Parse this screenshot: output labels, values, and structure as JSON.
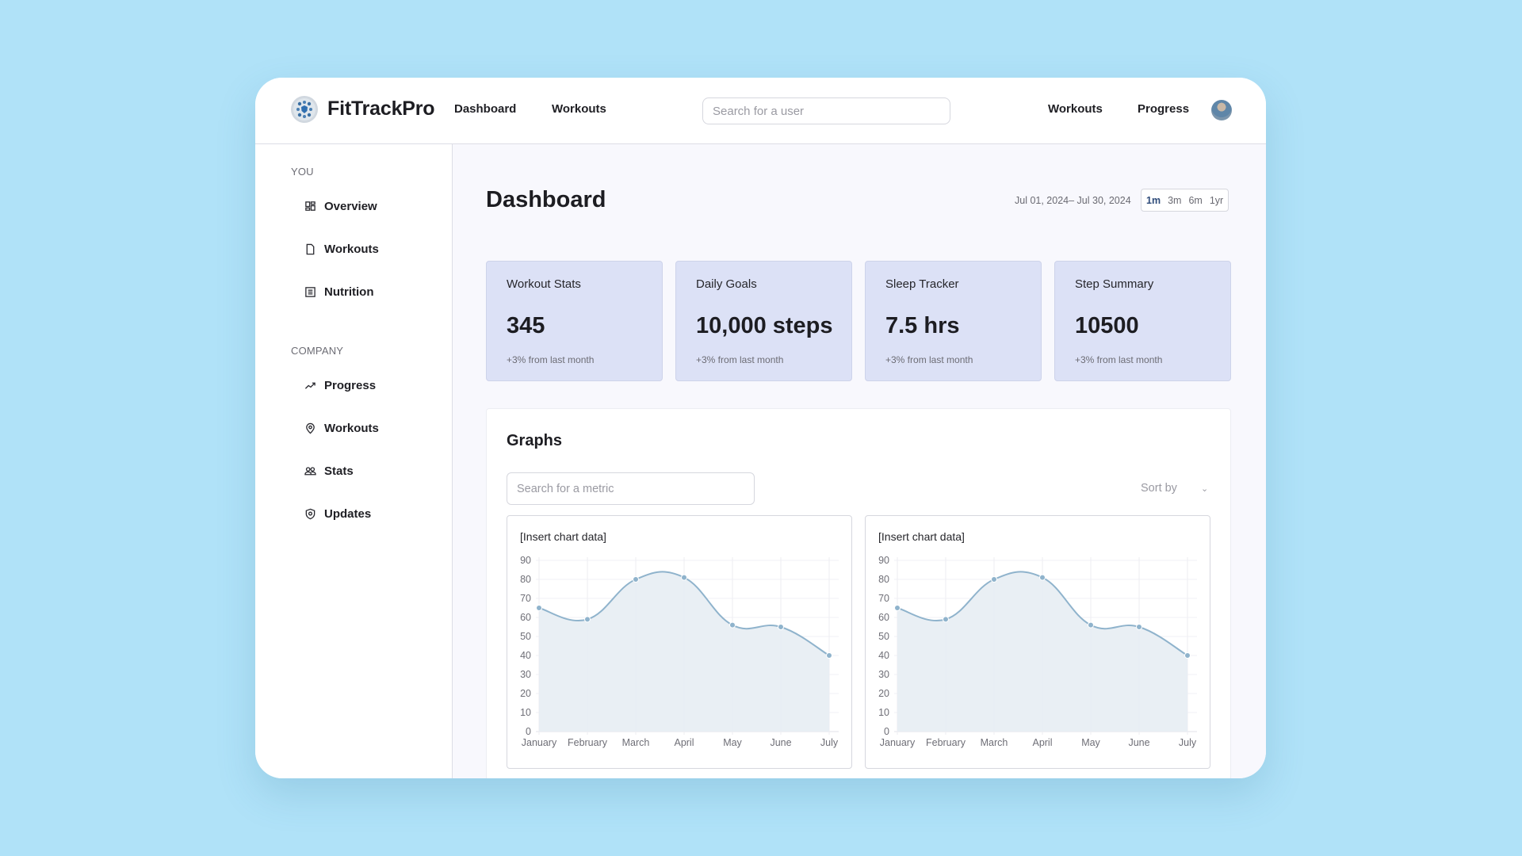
{
  "header": {
    "brand": "FitTrackPro",
    "nav_left": [
      "Dashboard",
      "Workouts"
    ],
    "search_placeholder": "Search for a user",
    "nav_right": [
      "Workouts",
      "Progress"
    ]
  },
  "sidebar": {
    "sections": [
      {
        "label": "YOU",
        "items": [
          {
            "label": "Overview",
            "icon": "grid-icon"
          },
          {
            "label": "Workouts",
            "icon": "file-icon"
          },
          {
            "label": "Nutrition",
            "icon": "list-icon"
          }
        ]
      },
      {
        "label": "COMPANY",
        "items": [
          {
            "label": "Progress",
            "icon": "trending-up-icon"
          },
          {
            "label": "Workouts",
            "icon": "map-pin-icon"
          },
          {
            "label": "Stats",
            "icon": "users-icon"
          },
          {
            "label": "Updates",
            "icon": "shield-icon"
          }
        ]
      }
    ]
  },
  "main": {
    "title": "Dashboard",
    "date_range": "Jul 01, 2024– Jul 30, 2024",
    "ranges": [
      "1m",
      "3m",
      "6m",
      "1yr"
    ],
    "active_range": "1m",
    "stats": [
      {
        "title": "Workout Stats",
        "value": "345",
        "delta": "+3% from last month"
      },
      {
        "title": "Daily Goals",
        "value": "10,000 steps",
        "delta": "+3% from last month"
      },
      {
        "title": "Sleep Tracker",
        "value": "7.5 hrs",
        "delta": "+3% from last month"
      },
      {
        "title": "Step Summary",
        "value": "10500",
        "delta": "+3% from last month"
      }
    ],
    "graphs": {
      "title": "Graphs",
      "search_placeholder": "Search for a metric",
      "sort_label": "Sort by"
    }
  },
  "colors": {
    "background": "#b0e2f8",
    "card_fill": "#dce1f6",
    "line": "#8fb3cc",
    "area": "#e8eef3",
    "active_range": "#2f4c7a"
  },
  "chart_data": [
    {
      "type": "line",
      "title": "[Insert chart data]",
      "categories": [
        "January",
        "February",
        "March",
        "April",
        "May",
        "June",
        "July"
      ],
      "series": [
        {
          "name": "",
          "values": [
            65,
            59,
            80,
            81,
            56,
            55,
            40
          ]
        }
      ],
      "xlabel": "",
      "ylabel": "",
      "ylim": [
        0,
        90
      ],
      "yticks": [
        0,
        10,
        20,
        30,
        40,
        50,
        60,
        70,
        80,
        90
      ],
      "fill": true,
      "smooth": true,
      "grid": true,
      "legend": "none"
    },
    {
      "type": "line",
      "title": "[Insert chart data]",
      "categories": [
        "January",
        "February",
        "March",
        "April",
        "May",
        "June",
        "July"
      ],
      "series": [
        {
          "name": "",
          "values": [
            65,
            59,
            80,
            81,
            56,
            55,
            40
          ]
        }
      ],
      "xlabel": "",
      "ylabel": "",
      "ylim": [
        0,
        90
      ],
      "yticks": [
        0,
        10,
        20,
        30,
        40,
        50,
        60,
        70,
        80,
        90
      ],
      "fill": true,
      "smooth": true,
      "grid": true,
      "legend": "none"
    }
  ]
}
